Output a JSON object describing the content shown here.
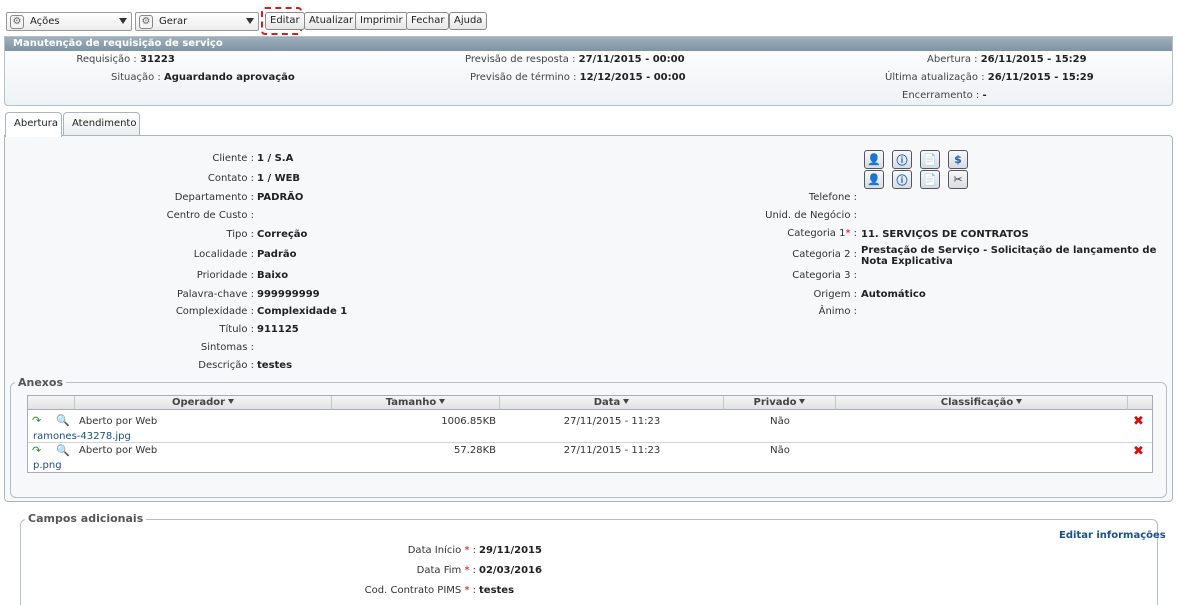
{
  "toolbar": {
    "acoes": "Ações",
    "gerar": "Gerar",
    "editar": "Editar",
    "atualizar": "Atualizar",
    "imprimir": "Imprimir",
    "fechar": "Fechar",
    "ajuda": "Ajuda"
  },
  "header": {
    "title": "Manutenção de requisição de serviço",
    "requisicao_label": "Requisição :",
    "requisicao_value": "31223",
    "situacao_label": "Situação :",
    "situacao_value": "Aguardando aprovação",
    "prev_resposta_label": "Previsão de resposta :",
    "prev_resposta_value": "27/11/2015 - 00:00",
    "prev_termino_label": "Previsão de término :",
    "prev_termino_value": "12/12/2015 - 00:00",
    "abertura_label": "Abertura :",
    "abertura_value": "26/11/2015 - 15:29",
    "ultima_label": "Última atualização :",
    "ultima_value": "26/11/2015 - 15:29",
    "encerramento_label": "Encerramento :",
    "encerramento_value": "-"
  },
  "tabs": [
    "Abertura",
    "Atendimento"
  ],
  "form_left": [
    {
      "label": "Cliente :",
      "value": "1 /  S.A"
    },
    {
      "label": "Contato :",
      "value": "1 / WEB"
    },
    {
      "label": "Departamento :",
      "value": "PADRÃO"
    },
    {
      "label": "Centro de Custo :",
      "value": ""
    },
    {
      "label": "Tipo :",
      "value": "Correção"
    },
    {
      "label": "Localidade :",
      "value": "Padrão"
    },
    {
      "label": "Prioridade :",
      "value": "Baixo"
    },
    {
      "label": "Palavra-chave :",
      "value": "999999999"
    },
    {
      "label": "Complexidade :",
      "value": "Complexidade 1"
    },
    {
      "label": "Título :",
      "value": "911125"
    },
    {
      "label": "Sintomas :",
      "value": ""
    },
    {
      "label": "Descrição :",
      "value": "testes"
    }
  ],
  "form_right": [
    {
      "label": "Telefone :",
      "value": ""
    },
    {
      "label": "Unid. de Negócio :",
      "value": ""
    },
    {
      "label": "Categoria 1",
      "value": "11. SERVIÇOS DE CONTRATOS"
    },
    {
      "label": "Categoria 2 :",
      "value": "Prestação de Serviço - Solicitação de lançamento de Nota Explicativa"
    },
    {
      "label": "Categoria 3 :",
      "value": ""
    },
    {
      "label": "Origem :",
      "value": "Automático"
    },
    {
      "label": "Ânimo :",
      "value": "-"
    }
  ],
  "anexos": {
    "legend": "Anexos",
    "columns": [
      "Operador",
      "Tamanho",
      "Data",
      "Privado",
      "Classificação"
    ],
    "rows": [
      {
        "operador": "Aberto por Web",
        "tamanho": "1006.85KB",
        "data": "27/11/2015 - 11:23",
        "privado": "Não",
        "classificacao": "",
        "file": "ramones-43278.jpg"
      },
      {
        "operador": "Aberto por Web",
        "tamanho": "57.28KB",
        "data": "27/11/2015 - 11:23",
        "privado": "Não",
        "classificacao": "",
        "file": "p.png"
      }
    ]
  },
  "campos": {
    "legend": "Campos adicionais",
    "edit_link": "Editar informações",
    "fields": [
      {
        "label": "Data Início",
        "value": "29/11/2015"
      },
      {
        "label": "Data Fim",
        "value": "02/03/2016"
      },
      {
        "label": "Cod. Contrato PIMS",
        "value": "testes"
      }
    ]
  }
}
